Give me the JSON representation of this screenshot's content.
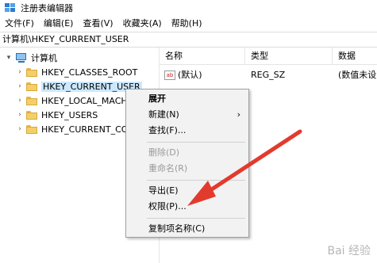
{
  "window": {
    "title": "注册表编辑器"
  },
  "menubar": [
    {
      "label": "文件(F)"
    },
    {
      "label": "编辑(E)"
    },
    {
      "label": "查看(V)"
    },
    {
      "label": "收藏夹(A)"
    },
    {
      "label": "帮助(H)"
    }
  ],
  "address": {
    "path": "计算机\\HKEY_CURRENT_USER"
  },
  "tree": {
    "root": {
      "label": "计算机",
      "icon": "computer-icon"
    },
    "items": [
      {
        "label": "HKEY_CLASSES_ROOT"
      },
      {
        "label": "HKEY_CURRENT_USER",
        "selected": true
      },
      {
        "label": "HKEY_LOCAL_MACH"
      },
      {
        "label": "HKEY_USERS"
      },
      {
        "label": "HKEY_CURRENT_CO"
      }
    ]
  },
  "list": {
    "columns": [
      "名称",
      "类型",
      "数据"
    ],
    "rows": [
      {
        "name": "(默认)",
        "type": "REG_SZ",
        "data": "(数值未设",
        "icon": "ab"
      }
    ]
  },
  "context_menu": {
    "items": [
      {
        "label": "展开",
        "bold": true
      },
      {
        "label": "新建(N)",
        "submenu": true
      },
      {
        "label": "查找(F)..."
      },
      {
        "label": "删除(D)",
        "disabled": true
      },
      {
        "label": "重命名(R)",
        "disabled": true
      },
      {
        "label": "导出(E)"
      },
      {
        "label": "权限(P)..."
      },
      {
        "label": "复制项名称(C)"
      }
    ],
    "submenu_arrow": "›"
  },
  "annotation": {
    "arrow_color": "#e23b2e"
  },
  "watermark": {
    "text": "Bai 经验"
  }
}
